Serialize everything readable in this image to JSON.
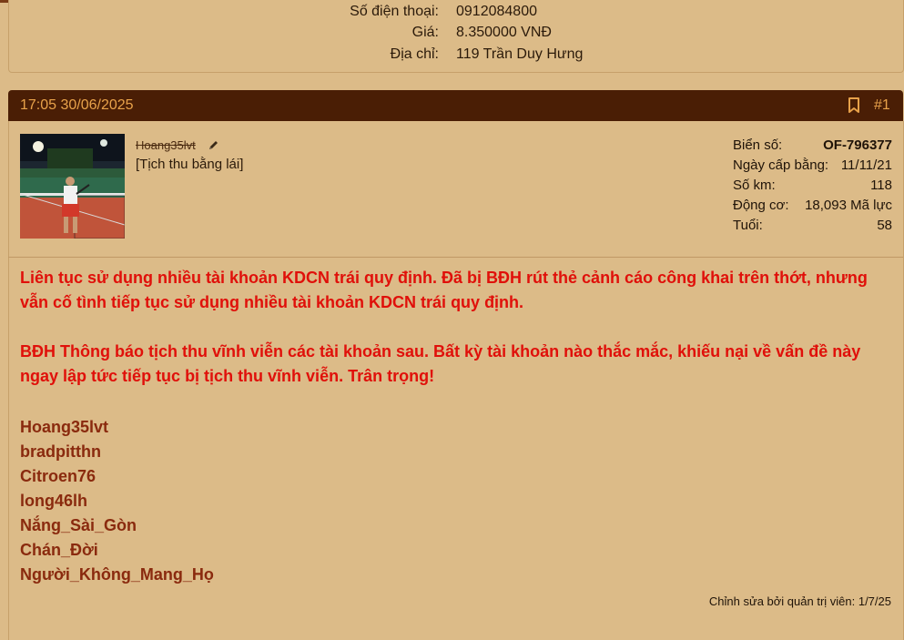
{
  "contact": {
    "phone_label": "Số điện thoại:",
    "phone_value": "0912084800",
    "price_label": "Giá:",
    "price_value": "8.350000 VNĐ",
    "address_label": "Địa chỉ:",
    "address_value": "119 Trần Duy Hưng"
  },
  "post": {
    "time": "17:05 30/06/2025",
    "number": "#1",
    "username": "Hoang35lvt",
    "user_title": "[Tịch thu bằng lái]",
    "stats": {
      "plate_label": "Biển số:",
      "plate_value": "OF-796377",
      "license_date_label": "Ngày cấp bằng:",
      "license_date_value": "11/11/21",
      "km_label": "Số km:",
      "km_value": "118",
      "engine_label": "Động cơ:",
      "engine_value": "18,093 Mã lực",
      "age_label": "Tuổi:",
      "age_value": "58"
    },
    "message_p1": "Liên tục sử dụng nhiều tài khoản KDCN trái quy định. Đã bị BĐH rút thẻ cảnh cáo công khai trên thớt, nhưng vẫn cố tình tiếp tục sử dụng nhiều tài khoản KDCN trái quy định.",
    "message_p2": "BĐH Thông báo tịch thu vĩnh viễn các tài khoản sau. Bất kỳ tài khoản nào thắc mắc, khiếu nại về vấn đề này ngay lập tức tiếp tục bị tịch thu vĩnh viễn. Trân trọng!",
    "accounts": [
      "Hoang35lvt",
      "bradpitthn",
      "Citroen76",
      "long46lh",
      "Nắng_Sài_Gòn",
      "Chán_Đời",
      "Người_Không_Mang_Họ"
    ],
    "edited_note": "Chỉnh sửa bởi quản trị viên: 1/7/25"
  },
  "colors": {
    "header_bg": "#4a1e05",
    "header_text": "#e8a24a",
    "message_red": "#e0100a",
    "account_brown": "#8a2a0e"
  },
  "icons": [
    "bookmark-icon",
    "pencil-edit-icon"
  ]
}
